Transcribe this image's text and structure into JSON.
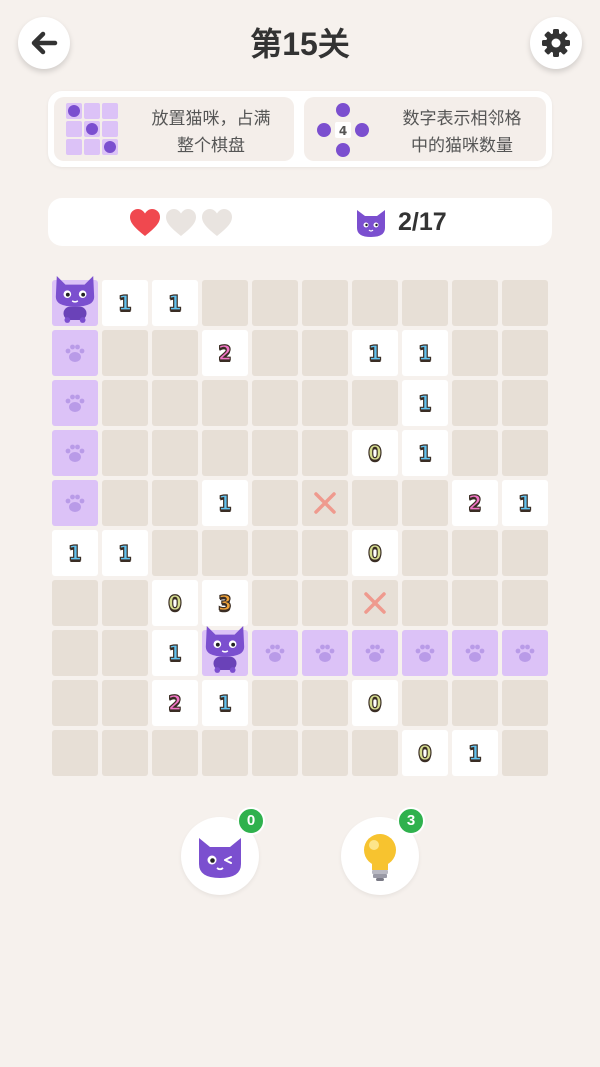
{
  "header": {
    "title": "第15关",
    "back_icon": "arrow-left-icon",
    "settings_icon": "gear-icon"
  },
  "tutorial": {
    "tip1_line1": "放置猫咪，占满",
    "tip1_line2": "整个棋盘",
    "tip2_line1": "数字表示相邻格",
    "tip2_line2": "中的猫咪数量",
    "tip2_example_number": "4"
  },
  "status": {
    "lives_total": 3,
    "lives_remaining": 1,
    "cats_placed": "2/17"
  },
  "board": {
    "rows": 10,
    "cols": 10,
    "cells": [
      [
        "cat",
        "1",
        "1",
        "",
        "",
        "",
        "",
        "",
        "",
        ""
      ],
      [
        "paw",
        "",
        "",
        "2",
        "",
        "",
        "1",
        "1",
        "",
        ""
      ],
      [
        "paw",
        "",
        "",
        "",
        "",
        "",
        "",
        "1",
        "",
        ""
      ],
      [
        "paw",
        "",
        "",
        "",
        "",
        "",
        "0",
        "1",
        "",
        ""
      ],
      [
        "paw",
        "",
        "",
        "1",
        "",
        "x",
        "",
        "",
        "2",
        "1"
      ],
      [
        "1",
        "1",
        "",
        "",
        "",
        "",
        "0",
        "",
        "",
        ""
      ],
      [
        "",
        "",
        "0",
        "3",
        "",
        "",
        "x",
        "",
        "",
        ""
      ],
      [
        "",
        "",
        "1",
        "cat",
        "paw",
        "paw",
        "paw",
        "paw",
        "paw",
        "paw"
      ],
      [
        "",
        "",
        "2",
        "1",
        "",
        "",
        "0",
        "",
        "",
        ""
      ],
      [
        "",
        "",
        "",
        "",
        "",
        "",
        "",
        "0",
        "1",
        ""
      ]
    ]
  },
  "powerups": {
    "cat_count": "0",
    "hint_count": "3",
    "cat_icon": "cat-wink-icon",
    "hint_icon": "lightbulb-icon"
  },
  "colors": {
    "background": "#f6f1ed",
    "empty_cell": "#e7dfd6",
    "paw_cell": "#dcc2f7",
    "clue_cell": "#ffffff",
    "heart_full": "#f0484f",
    "badge": "#2fb14d"
  }
}
